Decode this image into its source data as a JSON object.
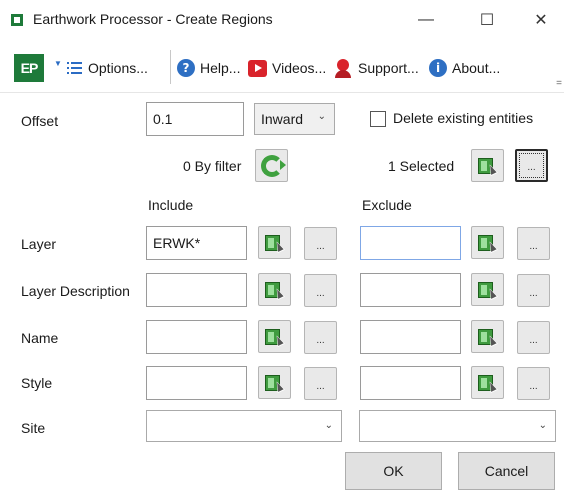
{
  "window": {
    "title": "Earthwork Processor - Create Regions",
    "minimize_glyph": "—",
    "maximize_glyph": "☐",
    "close_glyph": "✕"
  },
  "toolbar": {
    "logo_text": "EP",
    "dropdown_caret": "▼",
    "options_label": "Options...",
    "help_label": "Help...",
    "videos_label": "Videos...",
    "support_label": "Support...",
    "about_label": "About...",
    "help_icon_glyph": "?",
    "about_icon_glyph": "i",
    "overflow_glyph": "="
  },
  "offset": {
    "label": "Offset",
    "value": "0.1",
    "direction": "Inward",
    "direction_caret": "⌄"
  },
  "delete_existing": {
    "label": "Delete existing entities",
    "checked": false
  },
  "filter": {
    "by_filter_label": "0 By filter",
    "selected_label": "1 Selected"
  },
  "columns": {
    "include": "Include",
    "exclude": "Exclude"
  },
  "rows": [
    {
      "label": "Layer",
      "include_value": "ERWK*",
      "exclude_value": ""
    },
    {
      "label": "Layer Description",
      "include_value": "",
      "exclude_value": ""
    },
    {
      "label": "Name",
      "include_value": "",
      "exclude_value": ""
    },
    {
      "label": "Style",
      "include_value": "",
      "exclude_value": ""
    }
  ],
  "site": {
    "label": "Site",
    "include_value": "",
    "exclude_value": "",
    "caret": "⌄"
  },
  "ellipsis_label": "...",
  "buttons": {
    "ok": "OK",
    "cancel": "Cancel"
  },
  "colors": {
    "brand_green": "#1e7a3a",
    "focus_border": "#7fa7e6"
  },
  "icons": {
    "pick": "pick-objects-icon",
    "refresh": "refresh-icon",
    "help": "help-icon",
    "videos": "video-icon",
    "support": "support-icon",
    "about": "info-icon",
    "options": "list-icon"
  }
}
